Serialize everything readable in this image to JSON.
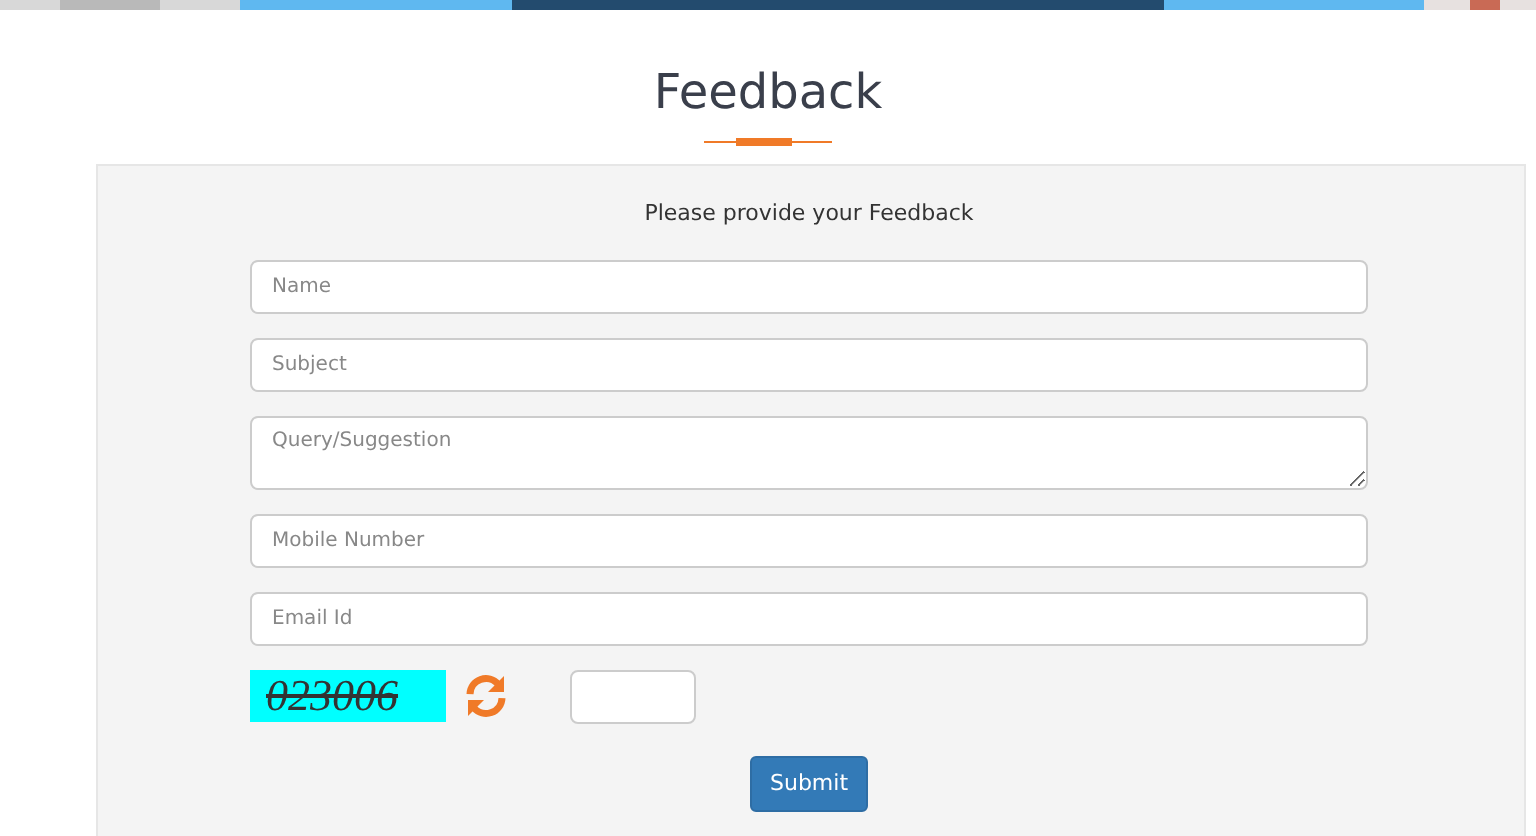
{
  "title": "Feedback",
  "form": {
    "heading": "Please provide your Feedback",
    "fields": [
      {
        "kind": "input",
        "placeholder": "Name"
      },
      {
        "kind": "input",
        "placeholder": "Subject"
      },
      {
        "kind": "textarea",
        "placeholder": "Query/Suggestion"
      },
      {
        "kind": "input",
        "placeholder": "Mobile Number"
      },
      {
        "kind": "input",
        "placeholder": "Email Id"
      }
    ],
    "captcha": "023006",
    "submit": "Submit"
  }
}
